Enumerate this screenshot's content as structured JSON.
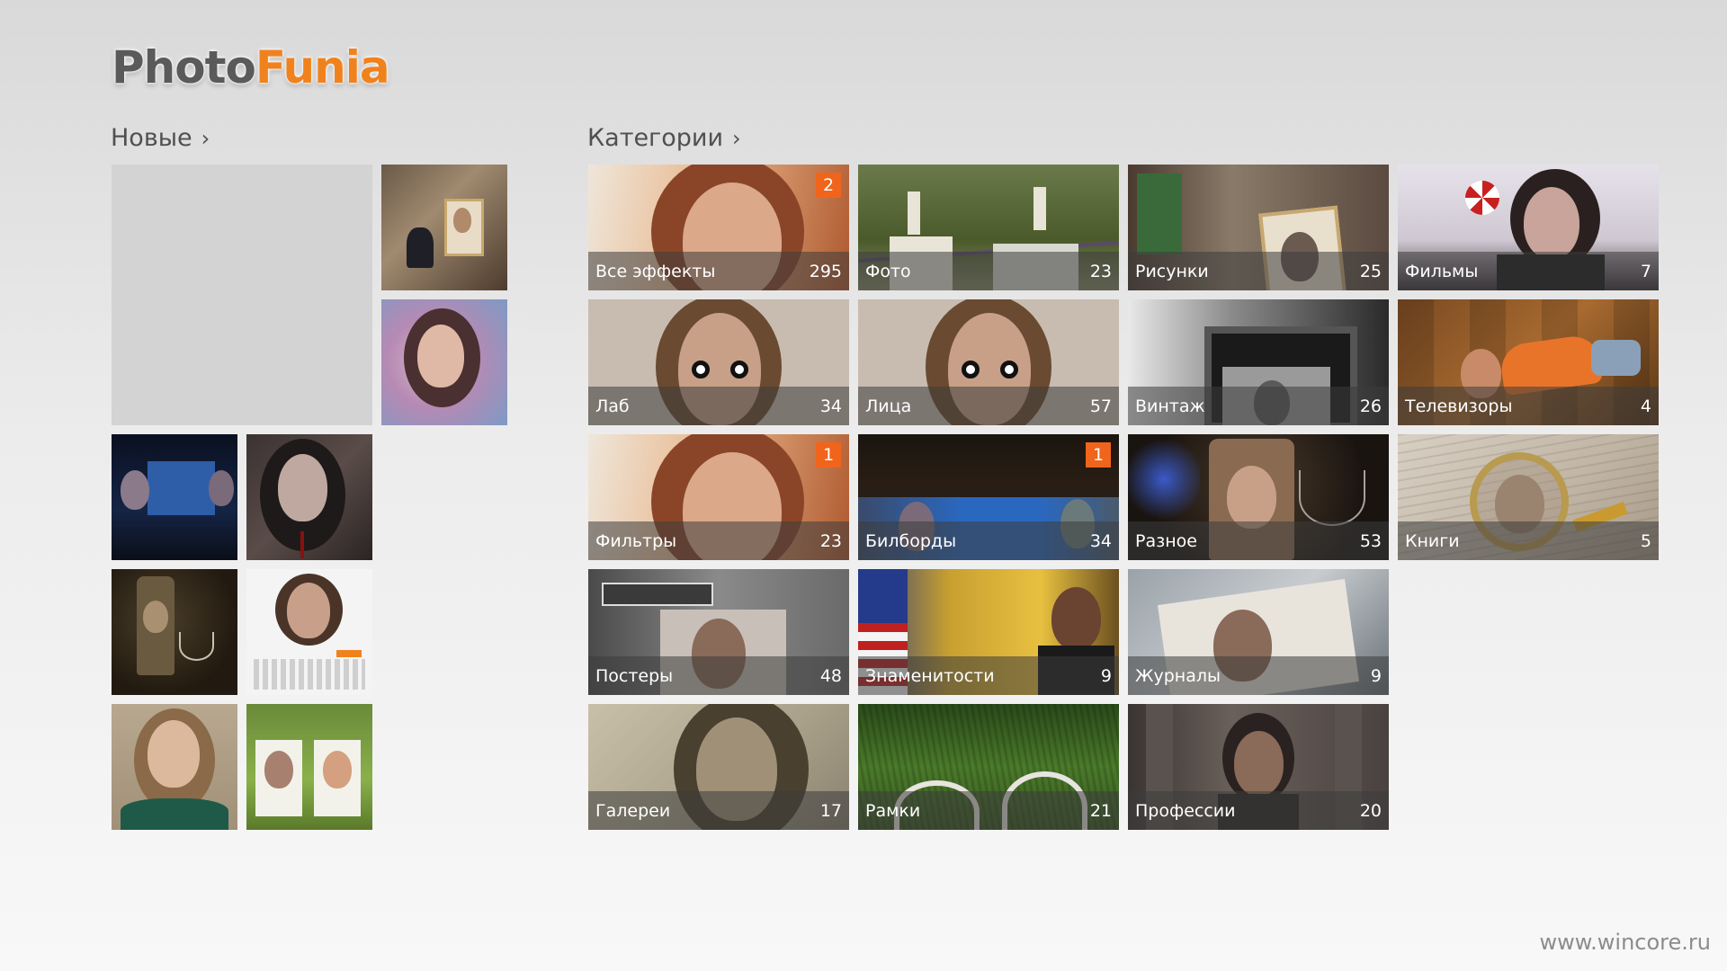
{
  "logo": {
    "part1": "Photo",
    "part2": "Funia"
  },
  "new_section": {
    "title": "Новые",
    "chevron": "›"
  },
  "categories_section": {
    "title": "Категории",
    "chevron": "›"
  },
  "categories": [
    {
      "label": "Все эффекты",
      "count": "295",
      "badge": "2"
    },
    {
      "label": "Фото",
      "count": "23"
    },
    {
      "label": "Рисунки",
      "count": "25"
    },
    {
      "label": "Фильмы",
      "count": "7"
    },
    {
      "label": "Лаб",
      "count": "34"
    },
    {
      "label": "Лица",
      "count": "57"
    },
    {
      "label": "Винтаж",
      "count": "26"
    },
    {
      "label": "Телевизоры",
      "count": "4"
    },
    {
      "label": "Фильтры",
      "count": "23",
      "badge": "1"
    },
    {
      "label": "Билборды",
      "count": "34",
      "badge": "1"
    },
    {
      "label": "Разное",
      "count": "53"
    },
    {
      "label": "Книги",
      "count": "5"
    },
    {
      "label": "Постеры",
      "count": "48"
    },
    {
      "label": "Знаменитости",
      "count": "9"
    },
    {
      "label": "Журналы",
      "count": "9"
    },
    {
      "label": "Галереи",
      "count": "17"
    },
    {
      "label": "Рамки",
      "count": "21"
    },
    {
      "label": "Профессии",
      "count": "20"
    }
  ],
  "watermark": "www.wincore.ru",
  "colors": {
    "accent": "#f0651b",
    "logo_orange": "#f0821e",
    "logo_gray": "#5a5a5a"
  }
}
